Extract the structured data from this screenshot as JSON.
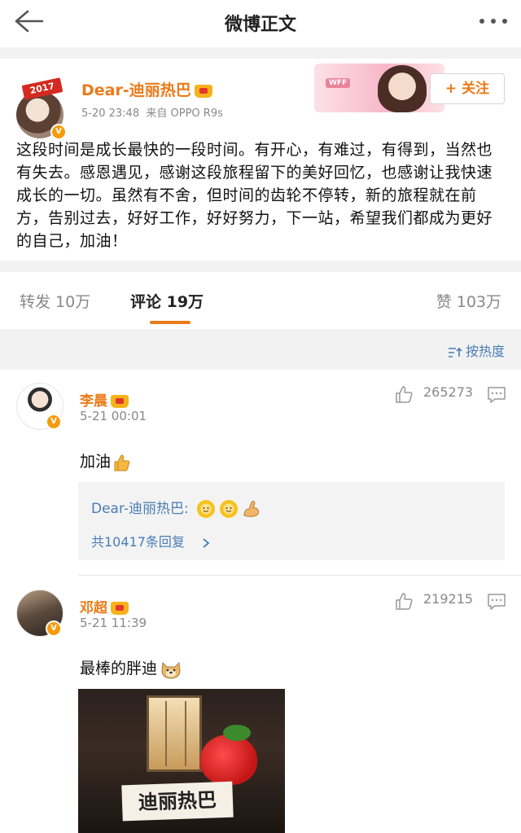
{
  "header": {
    "title": "微博正文"
  },
  "post": {
    "author": "Dear-迪丽热巴",
    "badge_year": "2017",
    "timestamp": "5-20 23:48",
    "source": "来自 OPPO R9s",
    "banner_label": "WFF",
    "follow_label": "+ 关注",
    "text": "这段时间是成长最快的一段时间。有开心，有难过，有得到，当然也有失去。感恩遇见，感谢这段旅程留下的美好回忆，也感谢让我快速成长的一切。虽然有不舍，但时间的齿轮不停转，新的旅程就在前方，告别过去，好好工作，好好努力，下一站，希望我们都成为更好的自己，加油！"
  },
  "tabs": {
    "repost": "转发  10万",
    "comment": "评论  19万",
    "like": "赞  103万"
  },
  "sort": {
    "label": "按热度"
  },
  "comments": [
    {
      "name": "李晨",
      "time": "5-21 00:01",
      "likes": "265273",
      "text": "加油",
      "reply_author": "Dear-迪丽热巴:",
      "reply_more": "共10417条回复"
    },
    {
      "name": "邓超",
      "time": "5-21 11:39",
      "likes": "219215",
      "text": "最棒的胖迪",
      "photo_label": "迪丽热巴"
    }
  ],
  "colors": {
    "accent_orange": "#eb7a18",
    "link_blue": "#4a7db5",
    "verified_gold": "#f59b0c"
  },
  "icons": [
    "back-arrow-icon",
    "more-icon",
    "crown-icon",
    "verified-icon",
    "sort-icon",
    "like-icon",
    "reply-icon",
    "thumbs-up-emoji-icon",
    "sunflower-emoji-icon",
    "muscle-emoji-icon",
    "doge-emoji-icon"
  ]
}
